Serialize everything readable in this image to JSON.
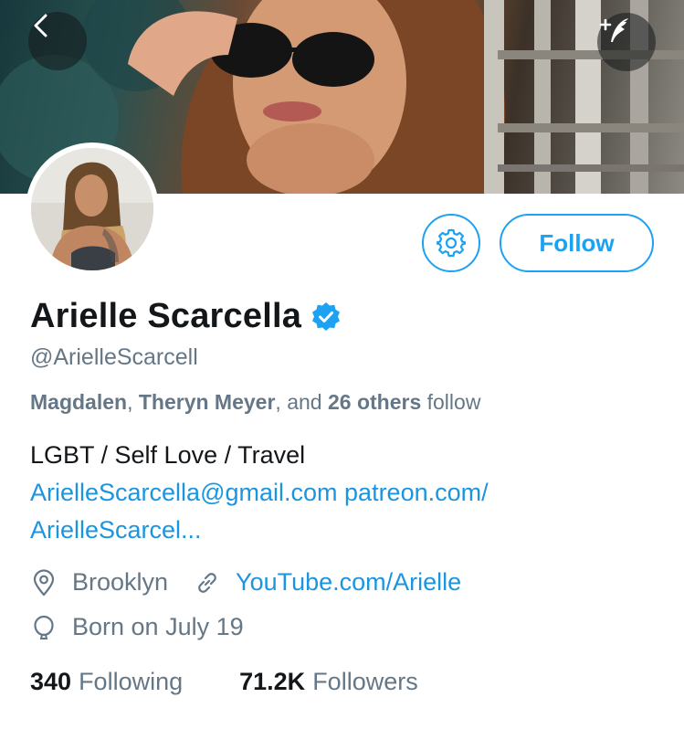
{
  "colors": {
    "accent": "#1da1f2",
    "link": "#1b95e0",
    "text_primary": "#14171a",
    "text_secondary": "#657786"
  },
  "header": {
    "back_icon": "chevron-left-icon",
    "compose_icon": "compose-tweet-icon"
  },
  "profile": {
    "name": "Arielle Scarcella",
    "verified": true,
    "handle": "@ArielleScarcell",
    "followed_by": {
      "user1": "Magdalen",
      "separator1": ", ",
      "user2": "Theryn Meyer",
      "separator2": ", and ",
      "others": "26 others",
      "suffix": " follow"
    },
    "bio_text": "LGBT / Self Love / Travel",
    "bio_links": [
      "ArielleScarcella@gmail.com",
      "patreon.com/",
      "ArielleScarcel..."
    ],
    "location": "Brooklyn",
    "website": "YouTube.com/Arielle",
    "birthday": "Born on July 19",
    "following_count": "340",
    "following_label": "Following",
    "followers_count": "71.2K",
    "followers_label": "Followers"
  },
  "actions": {
    "settings_icon": "gear-icon",
    "follow_label": "Follow"
  }
}
